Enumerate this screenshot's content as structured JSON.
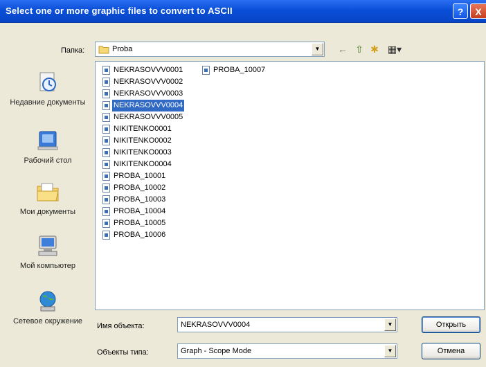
{
  "window": {
    "title": "Select one or more graphic files to convert to ASCII",
    "help_label": "?",
    "close_label": "X"
  },
  "lookin": {
    "label": "Папка:",
    "value": "Proba"
  },
  "toolbar": {
    "back_icon": "←",
    "up_icon": "⇧",
    "newfolder_icon": "✱",
    "views_icon": "▦▾"
  },
  "places": [
    {
      "label": "Недавние документы",
      "icon": "recent-documents-icon"
    },
    {
      "label": "Рабочий стол",
      "icon": "desktop-icon"
    },
    {
      "label": "Мои документы",
      "icon": "my-documents-icon"
    },
    {
      "label": "Мой компьютер",
      "icon": "my-computer-icon"
    },
    {
      "label": "Сетевое окружение",
      "icon": "network-icon"
    }
  ],
  "files": {
    "column1": [
      "NEKRASOVVV0001",
      "NEKRASOVVV0002",
      "NEKRASOVVV0003",
      "NEKRASOVVV0004",
      "NEKRASOVVV0005",
      "NIKITENKO0001",
      "NIKITENKO0002",
      "NIKITENKO0003",
      "NIKITENKO0004",
      "PROBA_10001",
      "PROBA_10002",
      "PROBA_10003",
      "PROBA_10004",
      "PROBA_10005",
      "PROBA_10006"
    ],
    "column2": [
      "PROBA_10007"
    ],
    "selected": "NEKRASOVVV0004"
  },
  "filename": {
    "label": "Имя объекта:",
    "value": "NEKRASOVVV0004"
  },
  "filetype": {
    "label": "Объекты типа:",
    "value": "Graph - Scope Mode"
  },
  "buttons": {
    "open": "Открыть",
    "cancel": "Отмена"
  },
  "colors": {
    "titlebar": "#0a4fd8",
    "selection": "#316ac5",
    "dialog_bg": "#ece9d8"
  }
}
